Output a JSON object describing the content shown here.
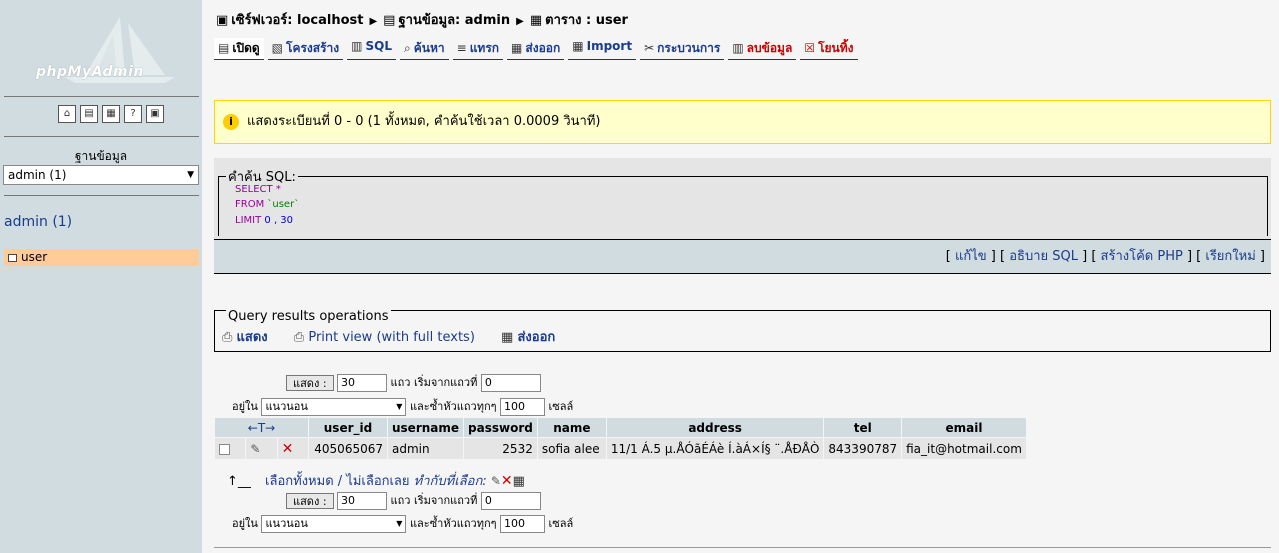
{
  "sidebar": {
    "logo": "phpMyAdmin",
    "db_label": "ฐานข้อมูล",
    "db_select": "admin (1)",
    "db_name": "admin (1)",
    "tables": [
      "user"
    ],
    "icons": [
      "home-icon",
      "sql-window-icon",
      "sql-query-icon",
      "help-icon",
      "documentation-icon"
    ]
  },
  "breadcrumb": {
    "server": "เซิร์ฟเวอร์: localhost",
    "database": "ฐานข้อมูล: admin",
    "table": "ตาราง : user"
  },
  "tabs": [
    {
      "label": "เปิดดู",
      "icon": "browse-icon"
    },
    {
      "label": "โครงสร้าง",
      "icon": "structure-icon"
    },
    {
      "label": "SQL",
      "icon": "sql-icon"
    },
    {
      "label": "ค้นหา",
      "icon": "search-icon"
    },
    {
      "label": "แทรก",
      "icon": "insert-icon"
    },
    {
      "label": "ส่งออก",
      "icon": "export-icon"
    },
    {
      "label": "Import",
      "icon": "import-icon"
    },
    {
      "label": "กระบวนการ",
      "icon": "operations-icon"
    },
    {
      "label": "ลบข้อมูล",
      "icon": "empty-icon"
    },
    {
      "label": "โยนทิ้ง",
      "icon": "drop-icon"
    }
  ],
  "notice": "แสดงระเบียนที่ 0 - 0 (1 ทั้งหมด, คำค้นใช้เวลา 0.0009 วินาที)",
  "sql": {
    "legend": "คำค้น SQL:",
    "line1_kw": "SELECT",
    "line1_rest": " *",
    "line2_kw": "FROM",
    "line2_rest": " `user`",
    "line3_kw": "LIMIT",
    "line3_rest": " 0 , 30"
  },
  "sql_actions": {
    "edit": "แก้ไข",
    "explain": "อธิบาย SQL",
    "php": "สร้างโค้ด PHP",
    "refresh": "เรียกใหม่"
  },
  "query_ops": {
    "legend": "Query results operations",
    "print": "แสดง",
    "print_full": "Print view (with full texts)",
    "export": "ส่งออก"
  },
  "nav_controls": {
    "show_button": "แสดง :",
    "rows_value": "30",
    "rows_label": "แถว เริ่มจากแถวที่",
    "start_value": "0",
    "in_label": "อยู่ใน",
    "mode_value": "แนวนอน",
    "repeat_label": "และซ้ำหัวแถวทุกๆ",
    "repeat_value": "100",
    "cells_label": "เซลล์"
  },
  "table": {
    "columns": [
      "user_id",
      "username",
      "password",
      "name",
      "address",
      "tel",
      "email"
    ],
    "rows": [
      {
        "user_id": "405065067",
        "username": "admin",
        "password": "2532",
        "name": "sofia alee",
        "address": "11/1 Á.5 µ.ÅÓãÉÁè Í.àÁ×Í§ ¨.ÅÐÅÒ",
        "tel": "843390787",
        "email": "fia_it@hotmail.com"
      }
    ]
  },
  "select_all": {
    "check_all": "เลือกทั้งหมด",
    "separator": " / ",
    "uncheck_all": "ไม่เลือกเลย",
    "with_selected": "ทำกับที่เลือก:"
  }
}
